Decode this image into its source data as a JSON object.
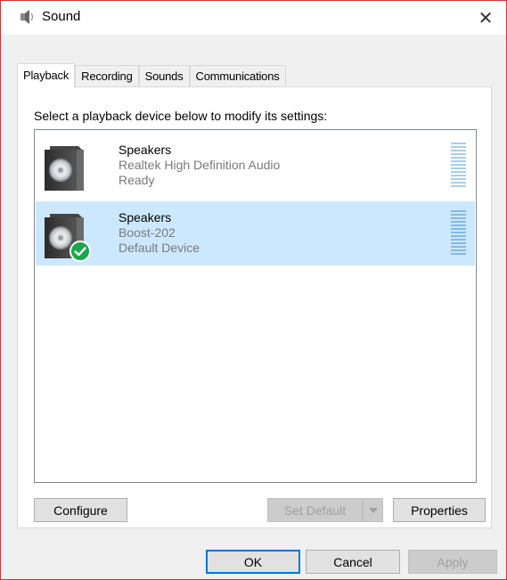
{
  "window": {
    "title": "Sound",
    "close_glyph": "✕",
    "border_color": "#d4312f"
  },
  "tabs": [
    {
      "label": "Playback",
      "active": true
    },
    {
      "label": "Recording",
      "active": false
    },
    {
      "label": "Sounds",
      "active": false
    },
    {
      "label": "Communications",
      "active": false
    }
  ],
  "instruction": "Select a playback device below to modify its settings:",
  "devices": [
    {
      "name": "Speakers",
      "description": "Realtek High Definition Audio",
      "status": "Ready",
      "selected": false,
      "default": false,
      "icon": "speaker-icon"
    },
    {
      "name": "Speakers",
      "description": "Boost-202",
      "status": "Default Device",
      "selected": true,
      "default": true,
      "icon": "speaker-icon"
    }
  ],
  "buttons": {
    "configure": "Configure",
    "set_default": "Set Default",
    "properties": "Properties",
    "ok": "OK",
    "cancel": "Cancel",
    "apply": "Apply"
  },
  "colors": {
    "selection": "#cce8ff",
    "accent": "#0078d7",
    "check": "#1aa64a"
  }
}
